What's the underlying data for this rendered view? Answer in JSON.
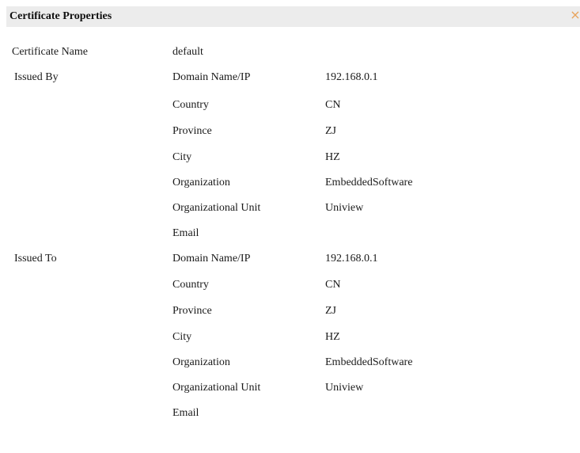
{
  "dialog": {
    "title": "Certificate Properties",
    "close_label": "×"
  },
  "cert_name": {
    "label": "Certificate Name",
    "value": "default"
  },
  "issued_by": {
    "label": "Issued By",
    "rows": [
      {
        "field": "Domain Name/IP",
        "value": "192.168.0.1"
      },
      {
        "field": "Country",
        "value": "CN"
      },
      {
        "field": "Province",
        "value": "ZJ"
      },
      {
        "field": "City",
        "value": "HZ"
      },
      {
        "field": "Organization",
        "value": "EmbeddedSoftware"
      },
      {
        "field": "Organizational Unit",
        "value": "Uniview"
      },
      {
        "field": "Email",
        "value": ""
      }
    ]
  },
  "issued_to": {
    "label": "Issued To",
    "rows": [
      {
        "field": "Domain Name/IP",
        "value": "192.168.0.1"
      },
      {
        "field": "Country",
        "value": "CN"
      },
      {
        "field": "Province",
        "value": "ZJ"
      },
      {
        "field": "City",
        "value": "HZ"
      },
      {
        "field": "Organization",
        "value": "EmbeddedSoftware"
      },
      {
        "field": "Organizational Unit",
        "value": "Uniview"
      },
      {
        "field": "Email",
        "value": ""
      }
    ]
  },
  "colors": {
    "title_bar_bg": "#ececec",
    "close_icon": "#e8a35a",
    "text": "#1a1a1a"
  }
}
